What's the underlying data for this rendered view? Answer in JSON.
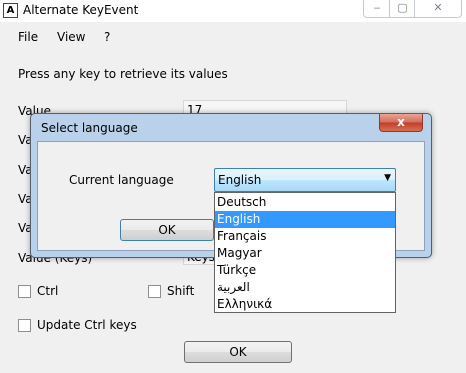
{
  "window": {
    "title": "Alternate KeyEvent",
    "icon_letter": "A",
    "controls": {
      "minimize": "‒",
      "maximize": "▢",
      "close": "✕"
    }
  },
  "menu": {
    "items": [
      "File",
      "View",
      "?"
    ]
  },
  "main": {
    "instruction": "Press any key to retrieve its values",
    "rows": [
      {
        "label": "Value",
        "value": "17"
      },
      {
        "label": "Va",
        "value": "####"
      },
      {
        "label": "Va",
        "value": ""
      },
      {
        "label": "Va",
        "value": ""
      },
      {
        "label": "Va",
        "value": ""
      },
      {
        "label": "Value (Keys)",
        "value": "Keys"
      }
    ],
    "ctrl_label": "Ctrl",
    "shift_label": "Shift",
    "update_ctrl_label": "Update Ctrl keys",
    "ok_label": "OK"
  },
  "dialog": {
    "title": "Select language",
    "close": "x",
    "current_language_label": "Current language",
    "selected": "English",
    "ok_label": "OK",
    "options": [
      "Deutsch",
      "English",
      "Français",
      "Magyar",
      "Türkçe",
      "العربية",
      "Ελληνικά"
    ],
    "selected_index": 1
  },
  "colors": {
    "dialog_frame": "#b9d1ea",
    "selection": "#3399ff",
    "close_red": "#c23d23"
  }
}
